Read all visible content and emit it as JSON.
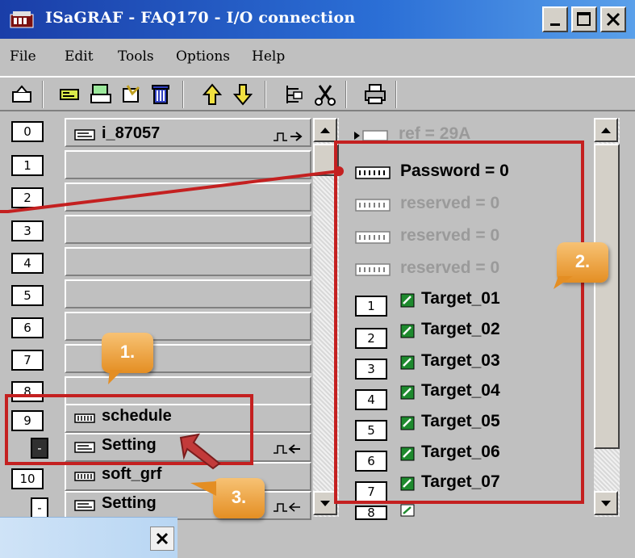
{
  "window": {
    "title": "ISaGRAF - FAQ170 - I/O connection"
  },
  "menu": [
    "File",
    "Edit",
    "Tools",
    "Options",
    "Help"
  ],
  "toolbar_icons": [
    "open-icon",
    "board-icon",
    "save-board-icon",
    "check-icon",
    "delete-icon",
    "arrow-up-icon",
    "arrow-down-icon",
    "tree-icon",
    "cut-icon",
    "print-icon"
  ],
  "slots": {
    "labels": [
      "0",
      "1",
      "2",
      "3",
      "4",
      "5",
      "6",
      "7",
      "8",
      "9",
      "-",
      "10",
      "-"
    ],
    "slot0_name": "i_87057",
    "slot9_name": "schedule",
    "slot9_sub": "Setting",
    "slot10_name": "soft_grf",
    "slot10_sub": "Setting"
  },
  "channels": {
    "ref": "ref = 29A",
    "params": [
      "Password = 0",
      "reserved = 0",
      "reserved = 0",
      "reserved = 0"
    ],
    "targets": [
      {
        "num": "1",
        "name": "Target_01"
      },
      {
        "num": "2",
        "name": "Target_02"
      },
      {
        "num": "3",
        "name": "Target_03"
      },
      {
        "num": "4",
        "name": "Target_04"
      },
      {
        "num": "5",
        "name": "Target_05"
      },
      {
        "num": "6",
        "name": "Target_06"
      },
      {
        "num": "7",
        "name": "Target_07"
      }
    ],
    "last_num": "8"
  },
  "callouts": [
    "1.",
    "2.",
    "3."
  ],
  "colors": {
    "title_bar": "#1a3ea8",
    "annotation": "#c42020",
    "callout": "#e48e23",
    "channel_icon": "#1e8a2e"
  }
}
